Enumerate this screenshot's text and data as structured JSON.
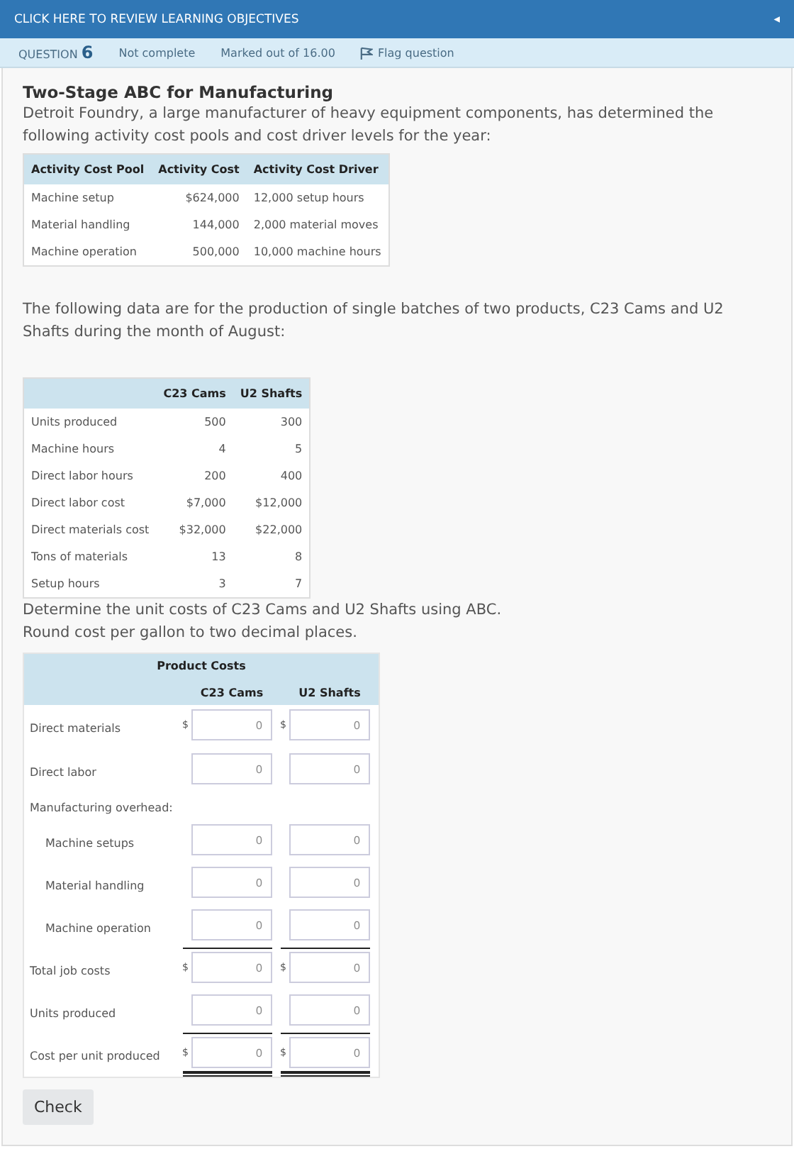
{
  "banner": {
    "label": "CLICK HERE TO REVIEW LEARNING OBJECTIVES",
    "collapse_icon": "◂"
  },
  "question_info": {
    "prefix": "QUESTION",
    "number": "6",
    "status": "Not complete",
    "marks": "Marked out of 16.00",
    "flag": "Flag question"
  },
  "title": "Two-Stage ABC for Manufacturing",
  "intro": "Detroit Foundry, a large manufacturer of heavy equipment components, has determined the following activity cost pools and cost driver levels for the year:",
  "pools_table": {
    "columns": [
      "Activity Cost Pool",
      "Activity Cost",
      "Activity Cost Driver"
    ],
    "rows": [
      [
        "Machine setup",
        "$624,000",
        "12,000 setup hours"
      ],
      [
        "Material handling",
        "144,000",
        "2,000 material moves"
      ],
      [
        "Machine operation",
        "500,000",
        "10,000 machine hours"
      ]
    ]
  },
  "data_intro": "The following data are for the production of single batches of two products, C23 Cams and U2 Shafts during the month of August:",
  "batch_table": {
    "columns": [
      "",
      "C23 Cams",
      "U2 Shafts"
    ],
    "rows": [
      [
        "Units produced",
        "500",
        "300"
      ],
      [
        "Machine hours",
        "4",
        "5"
      ],
      [
        "Direct labor hours",
        "200",
        "400"
      ],
      [
        "Direct labor cost",
        "$7,000",
        "$12,000"
      ],
      [
        "Direct materials cost",
        "$32,000",
        "$22,000"
      ],
      [
        "Tons of materials",
        "13",
        "8"
      ],
      [
        "Setup hours",
        "3",
        "7"
      ]
    ]
  },
  "instruction": [
    "Determine the unit costs of C23 Cams and U2 Shafts using ABC.",
    "Round cost per gallon to two decimal places."
  ],
  "cost_table": {
    "title": "Product Costs",
    "columns": [
      "C23 Cams",
      "U2 Shafts"
    ],
    "rows": [
      {
        "kind": "input",
        "label": "Direct materials",
        "indent": false,
        "underlined": false,
        "double": false,
        "currency": "$",
        "placeholders": [
          "0",
          "0"
        ]
      },
      {
        "kind": "input",
        "label": "Direct labor",
        "indent": false,
        "underlined": false,
        "double": false,
        "placeholders": [
          "0",
          "0"
        ]
      },
      {
        "kind": "heading",
        "label": "Manufacturing overhead:"
      },
      {
        "kind": "input",
        "label": "Machine setups",
        "indent": true,
        "underlined": false,
        "double": false,
        "placeholders": [
          "0",
          "0"
        ]
      },
      {
        "kind": "input",
        "label": "Material handling",
        "indent": true,
        "underlined": false,
        "double": false,
        "placeholders": [
          "0",
          "0"
        ]
      },
      {
        "kind": "input",
        "label": "Machine operation",
        "indent": true,
        "underlined": true,
        "double": false,
        "placeholders": [
          "0",
          "0"
        ]
      },
      {
        "kind": "input",
        "label": "Total job costs",
        "indent": false,
        "underlined": false,
        "double": false,
        "currency": "$",
        "placeholders": [
          "0",
          "0"
        ]
      },
      {
        "kind": "input",
        "label": "Units produced",
        "indent": false,
        "underlined": true,
        "double": false,
        "placeholders": [
          "0",
          "0"
        ]
      },
      {
        "kind": "input",
        "label": "Cost per unit produced",
        "indent": false,
        "underlined": true,
        "double": true,
        "currency": "$",
        "placeholders": [
          "0",
          "0"
        ]
      }
    ]
  },
  "check_button": "Check"
}
